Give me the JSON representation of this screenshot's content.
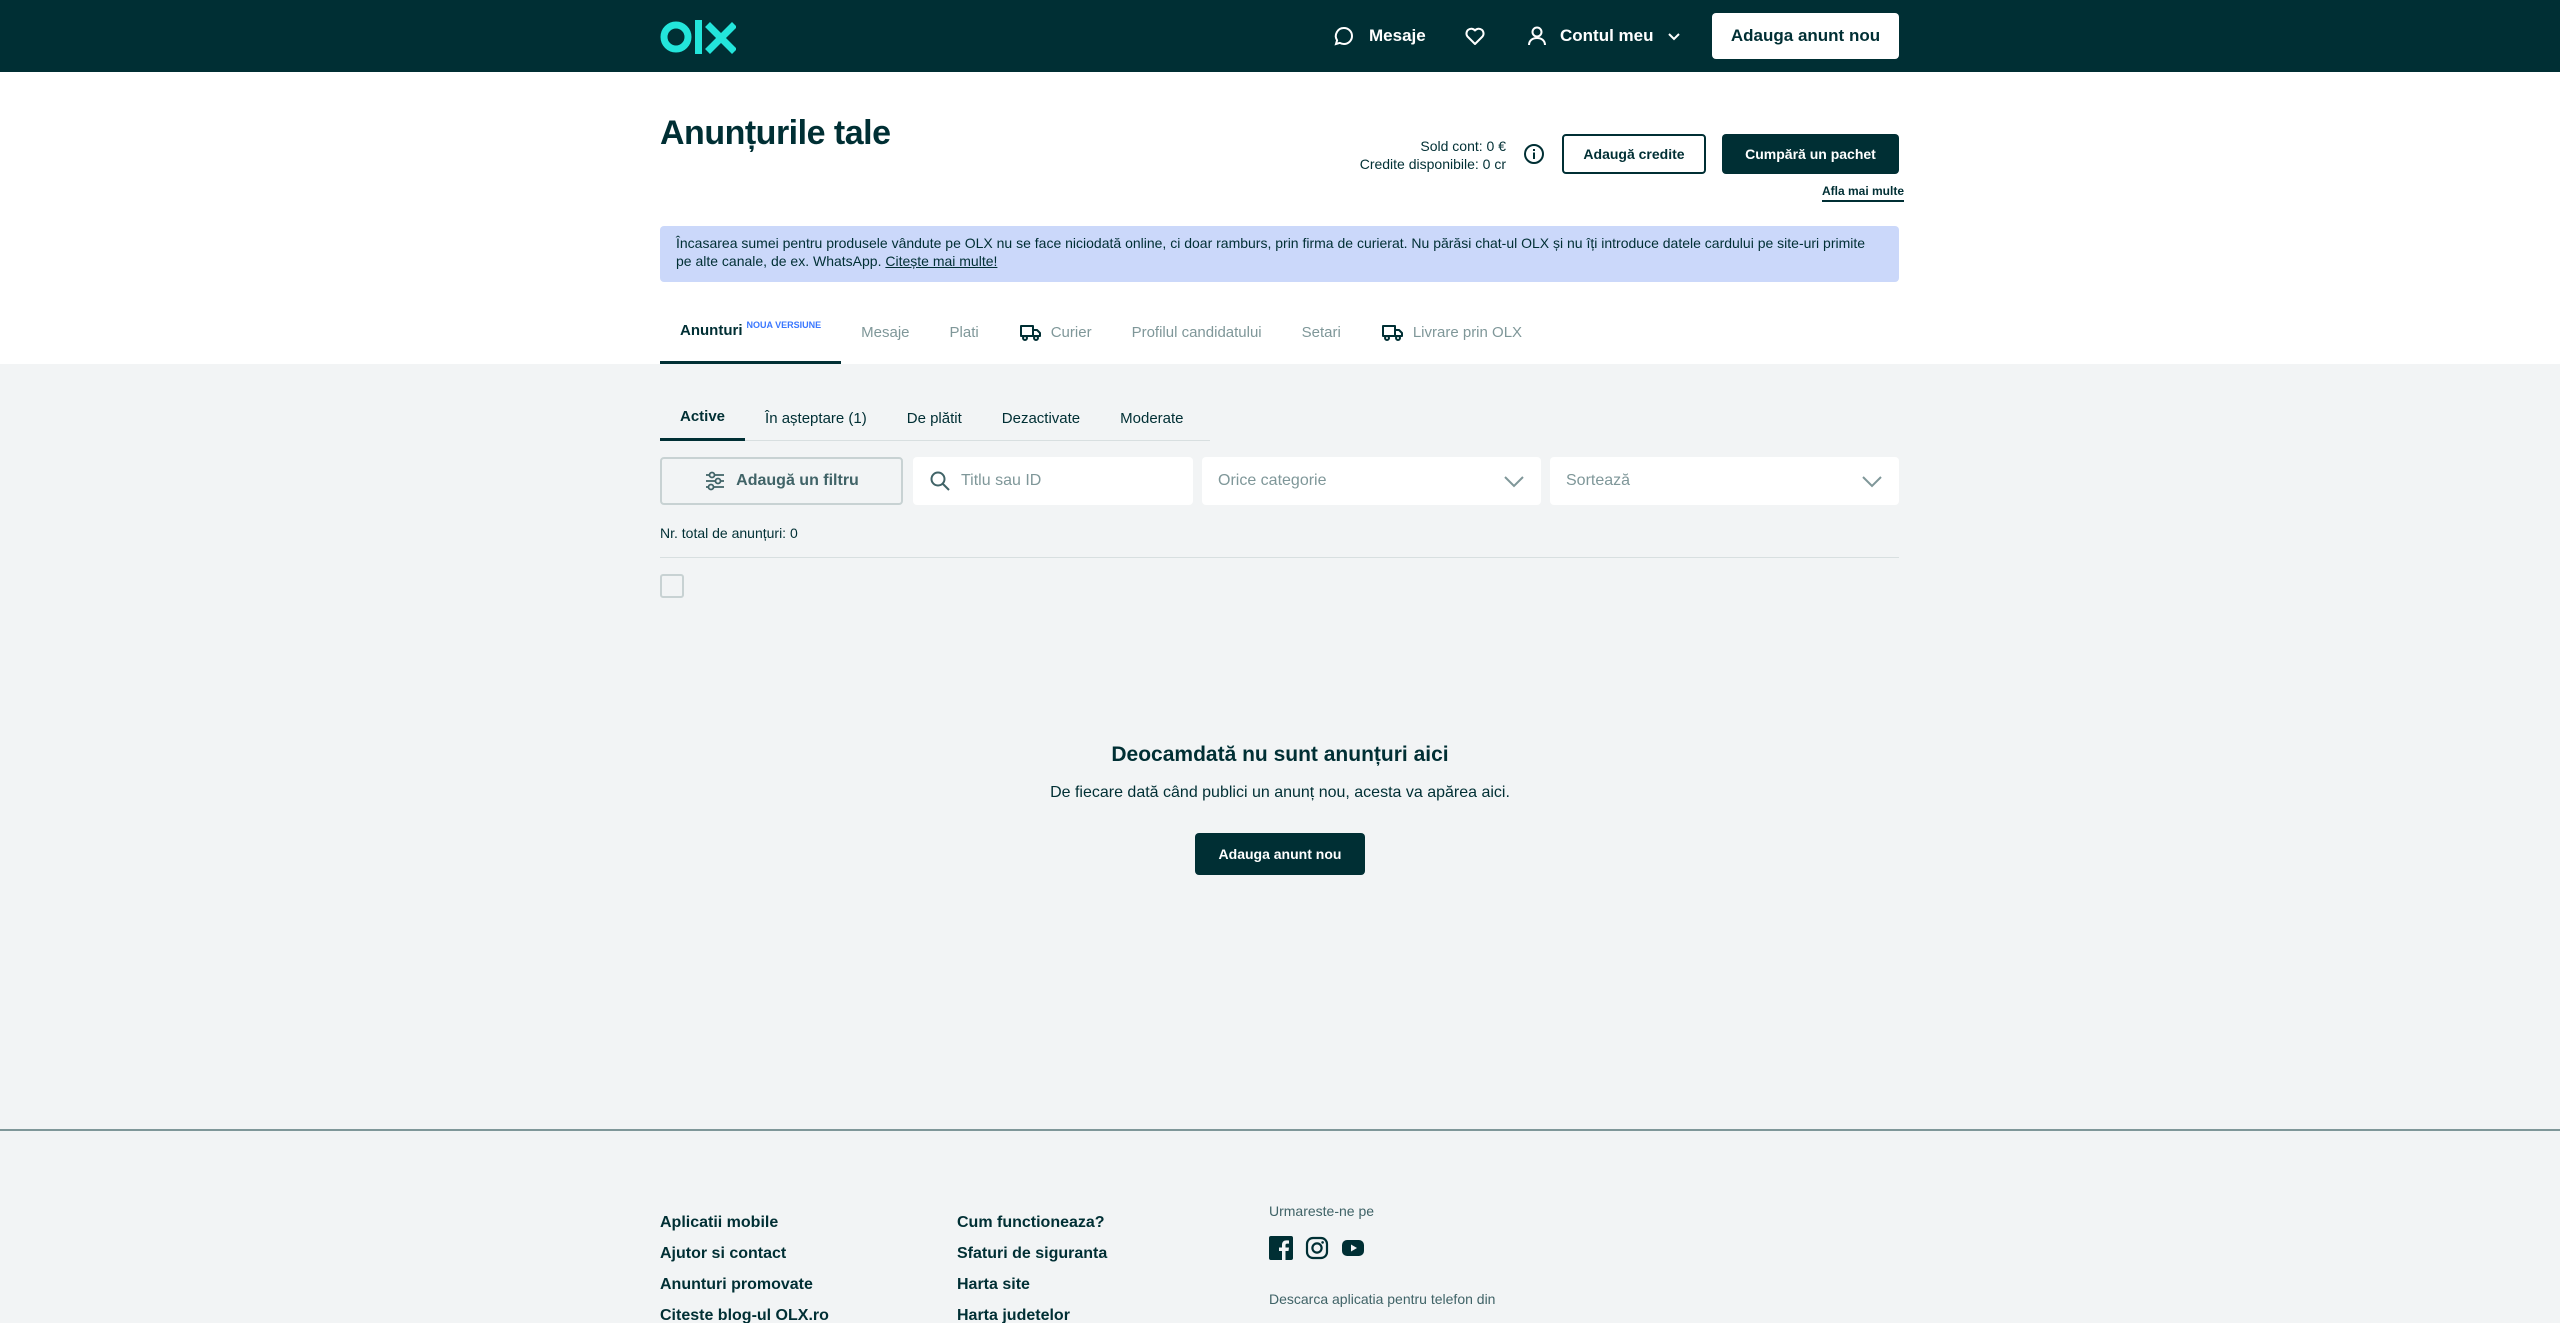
{
  "header": {
    "logo_text": "OLX",
    "messages_label": "Mesaje",
    "account_label": "Contul meu",
    "add_ad_label": "Adauga anunt nou"
  },
  "page": {
    "title": "Anunțurile tale",
    "balance_label": "Sold cont: 0 €",
    "credits_label": "Credite disponibile: 0 cr",
    "add_credits_label": "Adaugă credite",
    "buy_package_label": "Cumpără un pachet",
    "learn_more_label": "Afla mai multe"
  },
  "notice": {
    "text": "Încasarea sumei pentru produsele vândute pe OLX nu se face niciodată online, ci doar ramburs, prin firma de curierat. Nu părăsi chat-ul OLX și nu îți introduce datele cardului pe site-uri primite pe alte canale, de ex. WhatsApp.",
    "link": "Citește mai multe!"
  },
  "tabs": [
    {
      "label": "Anunturi",
      "badge": "NOUA VERSIUNE"
    },
    {
      "label": "Mesaje"
    },
    {
      "label": "Plati"
    },
    {
      "label": "Curier"
    },
    {
      "label": "Profilul candidatului"
    },
    {
      "label": "Setari"
    },
    {
      "label": "Livrare prin OLX"
    }
  ],
  "subtabs": [
    "Active",
    "În așteptare (1)",
    "De plătit",
    "Dezactivate",
    "Moderate"
  ],
  "filters": {
    "add_filter_label": "Adaugă un filtru",
    "search_placeholder": "Titlu sau ID",
    "category_label": "Orice categorie",
    "sort_label": "Sortează"
  },
  "total_label": "Nr. total de anunțuri: 0",
  "empty": {
    "title": "Deocamdată nu sunt anunțuri aici",
    "subtitle": "De fiecare dată când publici un anunț nou, acesta va apărea aici.",
    "button": "Adauga anunt nou"
  },
  "footer": {
    "col1": [
      "Aplicatii mobile",
      "Ajutor si contact",
      "Anunturi promovate",
      "Citeste blog-ul OLX.ro"
    ],
    "col2": [
      "Cum functioneaza?",
      "Sfaturi de siguranta",
      "Harta site",
      "Harta judetelor"
    ],
    "follow_label": "Urmareste-ne pe",
    "download_label": "Descarca aplicatia pentru telefon din"
  },
  "colors": {
    "brand_dark": "#002f34",
    "brand_accent": "#23e5db",
    "notice_bg": "#cbd8fa",
    "badge_blue": "#3a77ff"
  }
}
